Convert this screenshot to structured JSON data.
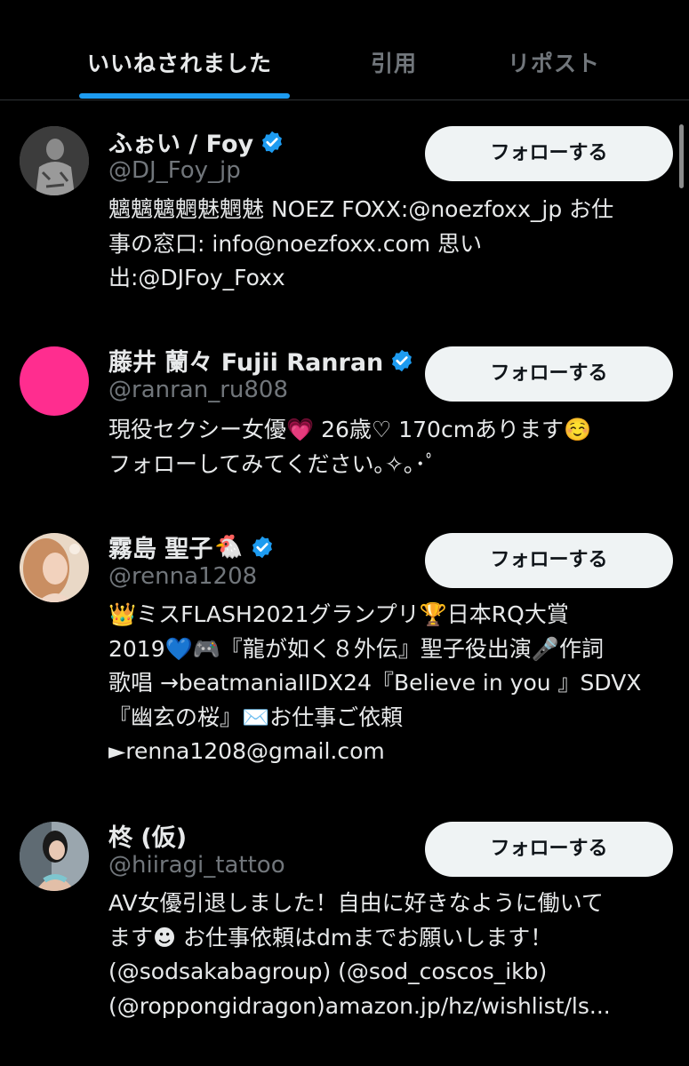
{
  "tabs": [
    {
      "label": "いいねされました",
      "active": true
    },
    {
      "label": "引用",
      "active": false
    },
    {
      "label": "リポスト",
      "active": false
    }
  ],
  "follow_label": "フォローする",
  "colors": {
    "accent": "#1d9bf0",
    "background": "#000000",
    "button": "#eff3f4"
  },
  "users": [
    {
      "name": "ふぉい / Foy",
      "handle": "@DJ_Foy_jp",
      "verified": true,
      "extra_emoji": "",
      "bio": "魑魑魑魍魅魍魅 NOEZ FOXX:@noezfoxx_jp お仕\n事の窓口: info@noezfoxx.com 思い\n出:@DJFoy_Foxx"
    },
    {
      "name": "藤井 蘭々 Fujii Ranran",
      "handle": "@ranran_ru808",
      "verified": true,
      "extra_emoji": "",
      "bio": "現役セクシー女優💗 26歳♡ 170cmあります☺️\nフォローしてみてください｡✧｡･ﾟ"
    },
    {
      "name": "霧島 聖子",
      "handle": "@renna1208",
      "verified": true,
      "extra_emoji": "🐔",
      "bio": "👑ミスFLASH2021グランプリ🏆日本RQ大賞\n2019💙🎮『龍が如く８外伝』聖子役出演🎤作詞\n歌唱 →beatmaniaIIDX24『Believe in you 』SDVX\n『幽玄の桜』✉️お仕事ご依頼\n►renna1208@gmail.com"
    },
    {
      "name": "柊 (仮)",
      "handle": "@hiiragi_tattoo",
      "verified": false,
      "extra_emoji": "",
      "bio": "AV女優引退しました！自由に好きなように働いて\nます☻ お仕事依頼はdmまでお願いします！\n(@sodsakabagroup) (@sod_coscos_ikb)\n(@roppongidragon)amazon.jp/hz/wishlist/ls..."
    }
  ]
}
